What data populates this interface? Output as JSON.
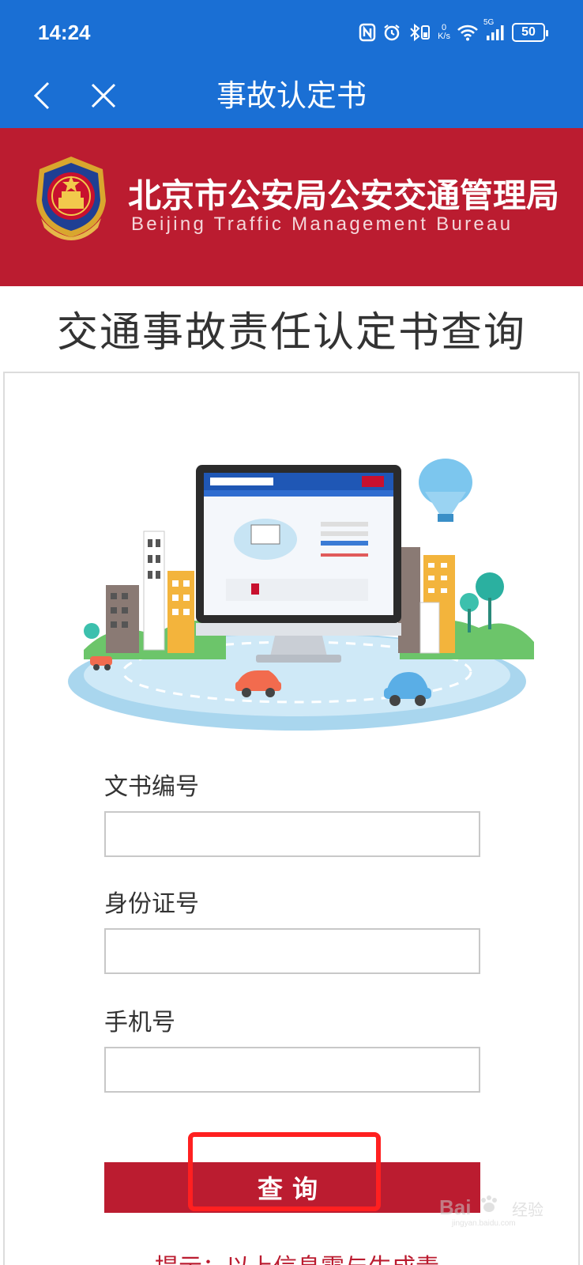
{
  "status_bar": {
    "time": "14:24",
    "network_speed_value": "0",
    "network_speed_unit": "K/s",
    "signal_label": "5G",
    "battery": "50"
  },
  "nav": {
    "title": "事故认定书"
  },
  "banner": {
    "bureau_name_cn": "北京市公安局公安交通管理局",
    "bureau_name_en": "Beijing Traffic Management Bureau"
  },
  "page": {
    "title": "交通事故责任认定书查询"
  },
  "form": {
    "doc_number_label": "文书编号",
    "doc_number_value": "",
    "id_number_label": "身份证号",
    "id_number_value": "",
    "phone_label": "手机号",
    "phone_value": "",
    "query_button": "查询",
    "hint_text": "提示：以上信息需与生成责"
  },
  "watermark": {
    "brand": "Bai",
    "brand_cn": "经验",
    "url": "jingyan.baidu.com"
  },
  "colors": {
    "header_blue": "#1a6fd4",
    "brand_red": "#bb1c30",
    "highlight_red": "#ff2020"
  }
}
